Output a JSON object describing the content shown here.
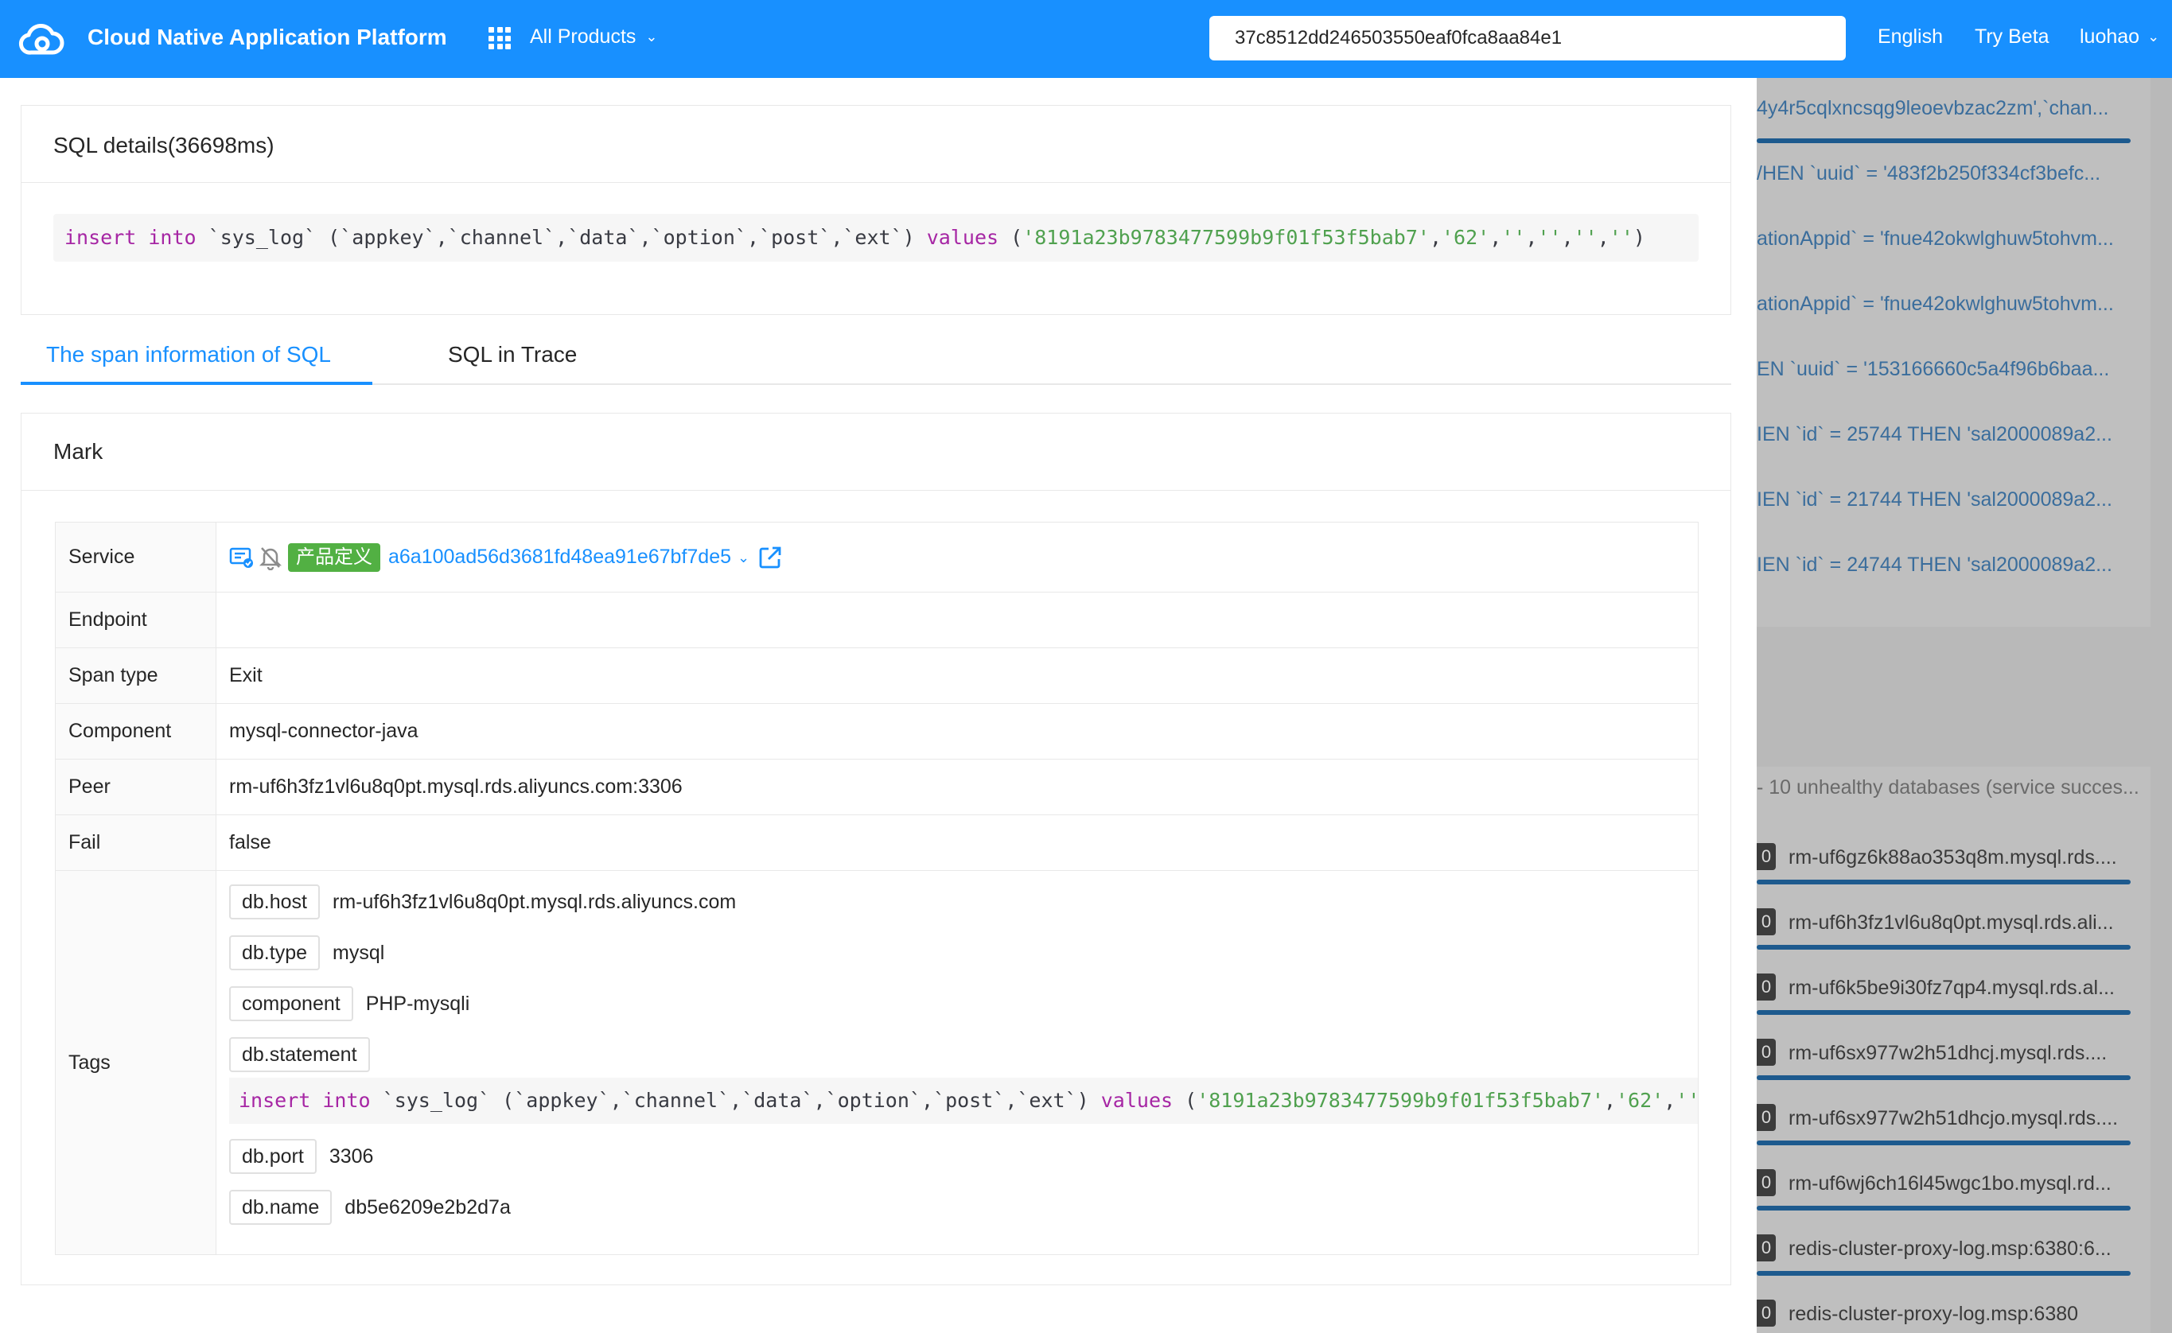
{
  "header": {
    "brand": "Cloud Native Application Platform",
    "all_products": "All Products",
    "search_value": "37c8512dd246503550eaf0fca8aa84e1",
    "language": "English",
    "try_beta": "Try Beta",
    "user": "luohao"
  },
  "sql_card": {
    "title": "SQL details(36698ms)",
    "statement": {
      "kw_insert": "insert",
      "kw_into": "into",
      "body": "`sys_log` (`appkey`,`channel`,`data`,`option`,`post`,`ext`)",
      "kw_values": "values",
      "open": "(",
      "str1": "'8191a23b9783477599b9f01f53f5bab7'",
      "str2": "'62'",
      "str3": "''",
      "str4": "''",
      "str5": "''",
      "str6": "''",
      "close": ")"
    }
  },
  "tabs": [
    {
      "label": "The span information of SQL",
      "active": true
    },
    {
      "label": "SQL in Trace",
      "active": false
    }
  ],
  "mark_card": {
    "title": "Mark",
    "rows": {
      "service": {
        "label": "Service",
        "badge": "产品定义",
        "link": "a6a100ad56d3681fd48ea91e67bf7de5"
      },
      "endpoint": {
        "label": "Endpoint",
        "value": ""
      },
      "span_type": {
        "label": "Span type",
        "value": "Exit"
      },
      "component": {
        "label": "Component",
        "value": "mysql-connector-java"
      },
      "peer": {
        "label": "Peer",
        "value": "rm-uf6h3fz1vl6u8q0pt.mysql.rds.aliyuncs.com:3306"
      },
      "fail": {
        "label": "Fail",
        "value": "false"
      },
      "tags": {
        "label": "Tags"
      }
    },
    "tags": {
      "db_host": {
        "key": "db.host",
        "value": "rm-uf6h3fz1vl6u8q0pt.mysql.rds.aliyuncs.com"
      },
      "db_type": {
        "key": "db.type",
        "value": "mysql"
      },
      "component": {
        "key": "component",
        "value": "PHP-mysqli"
      },
      "db_statement": {
        "key": "db.statement",
        "kw_insert": "insert",
        "kw_into": "into",
        "body": "`sys_log` (`appkey`,`channel`,`data`,`option`,`post`,`ext`)",
        "kw_values": "values",
        "open": "(",
        "str1": "'8191a23b9783477599b9f01f53f5bab7'",
        "str2": "'62'",
        "str3": "''",
        "str4": "'',"
      },
      "db_port": {
        "key": "db.port",
        "value": "3306"
      },
      "db_name": {
        "key": "db.name",
        "value": "db5e6209e2b2d7a"
      }
    }
  },
  "background": {
    "sql_rows": [
      "4y4r5cqlxncsqg9leoevbzac2zm',`chan...",
      "/HEN `uuid` = '483f2b250f334cf3befc...",
      "ationAppid` = 'fnue42okwlghuw5tohvm...",
      "ationAppid` = 'fnue42okwlghuw5tohvm...",
      "EN `uuid` = '153166660c5a4f96b6baa...",
      "IEN `id` = 25744 THEN 'sal2000089a2...",
      "IEN `id` = 21744 THEN 'sal2000089a2...",
      "IEN `id` = 24744 THEN 'sal2000089a2..."
    ],
    "unhealthy_heading": "- 10 unhealthy databases (service succes...",
    "db_rows": [
      {
        "badge": "0",
        "name": "rm-uf6gz6k88ao353q8m.mysql.rds...."
      },
      {
        "badge": "0",
        "name": "rm-uf6h3fz1vl6u8q0pt.mysql.rds.ali..."
      },
      {
        "badge": "0",
        "name": "rm-uf6k5be9i30fz7qp4.mysql.rds.al..."
      },
      {
        "badge": "0",
        "name": "rm-uf6sx977w2h51dhcj.mysql.rds...."
      },
      {
        "badge": "0",
        "name": "rm-uf6sx977w2h51dhcjo.mysql.rds...."
      },
      {
        "badge": "0",
        "name": "rm-uf6wj6ch16l45wgc1bo.mysql.rd..."
      },
      {
        "badge": "0",
        "name": "redis-cluster-proxy-log.msp:6380:6..."
      },
      {
        "badge": "0",
        "name": "redis-cluster-proxy-log.msp:6380"
      }
    ]
  },
  "colors": {
    "header_bg": "#1890ff",
    "accent": "#1890ff",
    "badge_green": "#52b043",
    "keyword": "#a626a4",
    "string": "#50a14f"
  },
  "icons": [
    "cloud-logo-icon",
    "apps-grid-icon",
    "chevron-down-icon",
    "service-card-icon",
    "bell-muted-icon",
    "external-link-icon"
  ]
}
